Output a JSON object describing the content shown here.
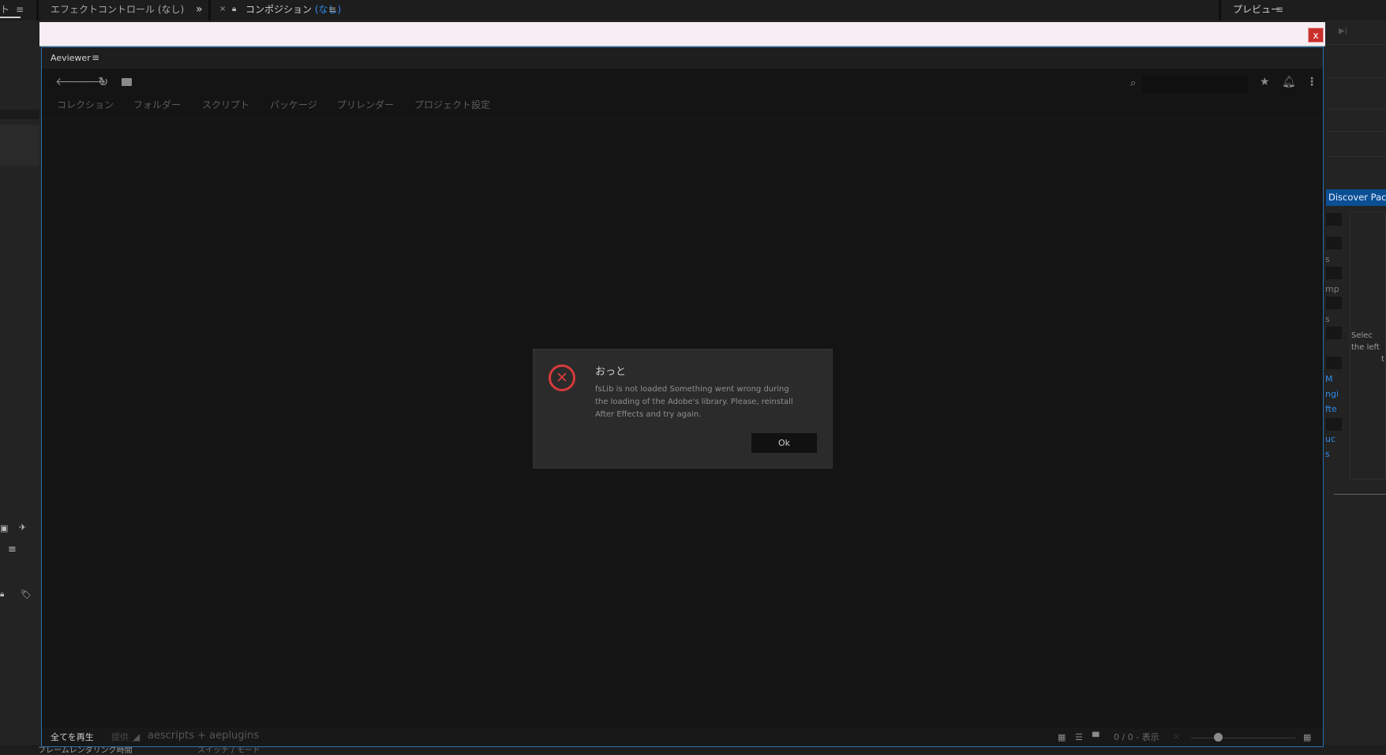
{
  "host": {
    "left_tab_fragment": "ト",
    "effect_controls": {
      "label": "エフェクトコントロール",
      "value": "(なし)"
    },
    "composition": {
      "close": "×",
      "label": "コンポジション",
      "value": "(なし)"
    },
    "preview": {
      "label": "プレビュー"
    },
    "expand_glyph": "»",
    "play_last_glyph": "▶|",
    "bottom_fragments": [
      "フレームレンダリング時間",
      "スイッチ / モード"
    ]
  },
  "aeviewer": {
    "title": "Aeviewer",
    "close_label": "x",
    "nav_tabs": [
      "コレクション",
      "フォルダー",
      "スクリプト",
      "パッケージ",
      "プリレンダー",
      "プロジェクト設定"
    ],
    "search_placeholder": "",
    "footer": {
      "play_all": "全てを再生",
      "provided_by": "提供",
      "brand": "aescripts + aeplugins",
      "count": "0 / 0 - 表示"
    }
  },
  "dialog": {
    "title": "おっと",
    "message": "fsLib is not loaded Something went wrong during the loading of the Adobe's library. Please, reinstall After Effects and try again.",
    "ok_label": "Ok"
  },
  "right_panel": {
    "discover_tab": "Discover Pack",
    "fragments_gray": [
      "s",
      "mp",
      "s"
    ],
    "fragments_link": [
      "M",
      "ngi",
      "fte",
      "uc",
      "s"
    ],
    "select_hint_lines": [
      "Selec",
      "the left",
      "t"
    ]
  },
  "colors": {
    "accent": "#2d8ceb",
    "error": "#d83a3a",
    "close": "#c9302c",
    "discover": "#0a4f94"
  }
}
